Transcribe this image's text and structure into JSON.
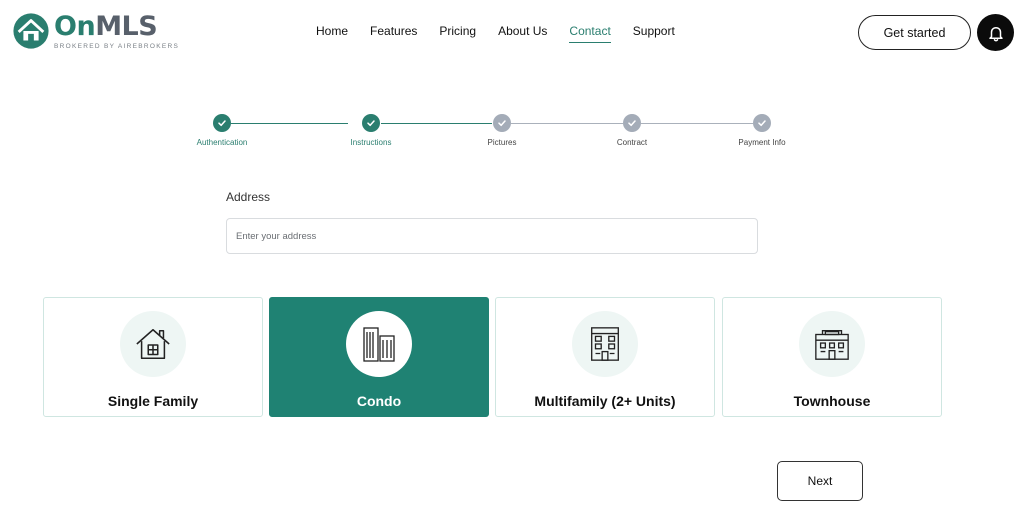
{
  "header": {
    "brand_on": "On",
    "brand_mls": "MLS",
    "tagline": "BROKERED BY AIREBROKERS",
    "nav": [
      {
        "label": "Home"
      },
      {
        "label": "Features"
      },
      {
        "label": "Pricing"
      },
      {
        "label": "About Us"
      },
      {
        "label": "Contact",
        "active": true
      },
      {
        "label": "Support"
      }
    ],
    "get_started_label": "Get started",
    "bell_icon": "bell-icon"
  },
  "stepper": {
    "steps": [
      {
        "label": "Authentication",
        "status": "done"
      },
      {
        "label": "Instructions",
        "status": "done"
      },
      {
        "label": "Pictures",
        "status": "todo"
      },
      {
        "label": "Contract",
        "status": "todo"
      },
      {
        "label": "Payment Info",
        "status": "todo"
      }
    ]
  },
  "address": {
    "label": "Address",
    "placeholder": "Enter your address",
    "value": ""
  },
  "property_types": [
    {
      "label": "Single Family",
      "icon": "house-icon",
      "selected": false
    },
    {
      "label": "Condo",
      "icon": "condo-buildings-icon",
      "selected": true
    },
    {
      "label": "Multifamily (2+ Units)",
      "icon": "apartment-building-icon",
      "selected": false
    },
    {
      "label": "Townhouse",
      "icon": "townhouse-icon",
      "selected": false
    }
  ],
  "next_label": "Next",
  "colors": {
    "brand_green": "#2a7e6f",
    "selected_card": "#1f8273",
    "step_todo": "#a4acb8",
    "icon_bg": "#eef6f4"
  }
}
